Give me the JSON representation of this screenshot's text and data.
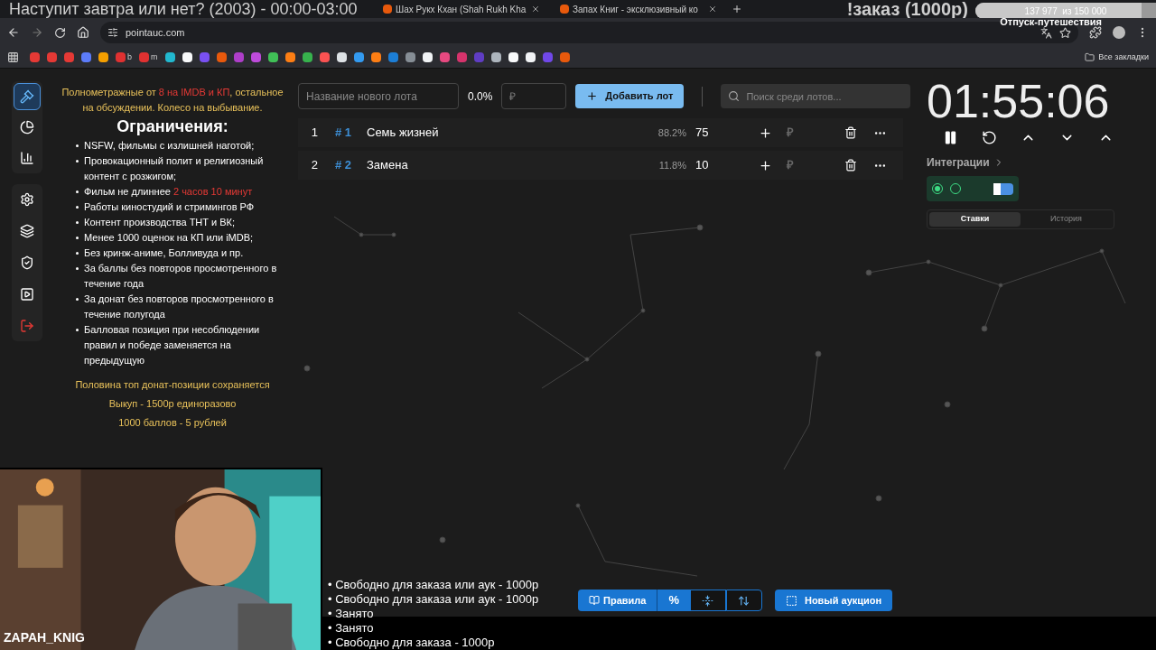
{
  "stream_title": "Наступит завтра или нет? (2003) - 00:00-03:00",
  "tabs": [
    {
      "title": "Шах Рукх Кхан (Shah Rukh Kha",
      "selected": false
    },
    {
      "title": "Запах Книг - эксклюзивный ко",
      "selected": false
    }
  ],
  "order_label": "!заказ (1000р)",
  "goal": {
    "reading": "137 977  из 150 000",
    "level": 0.92,
    "caption": "Отпуск-путешествия"
  },
  "address": "pointauc.com",
  "bookmarks": [
    {
      "color": "#e53935"
    },
    {
      "color": "#e53935"
    },
    {
      "color": "#e53935"
    },
    {
      "color": "#5c7cfa"
    },
    {
      "color": "#f59f00"
    },
    {
      "color": "#e03131",
      "label": "b"
    },
    {
      "color": "#e03131",
      "label": "m"
    },
    {
      "color": "#22b8cf"
    },
    {
      "color": "#f8f9fa"
    },
    {
      "color": "#7950f2"
    },
    {
      "color": "#e8590c"
    },
    {
      "color": "#ae3ec9"
    },
    {
      "color": "#be4bdb"
    },
    {
      "color": "#40c057"
    },
    {
      "color": "#fd7e14"
    },
    {
      "color": "#37b24d"
    },
    {
      "color": "#fa5252"
    },
    {
      "color": "#dee2e6"
    },
    {
      "color": "#339af0"
    },
    {
      "color": "#fd7e14"
    },
    {
      "color": "#1c7ed6"
    },
    {
      "color": "#868e96"
    },
    {
      "color": "#f1f3f5"
    },
    {
      "color": "#e64980"
    },
    {
      "color": "#d6336c"
    },
    {
      "color": "#5f3dc4"
    },
    {
      "color": "#adb5bd"
    },
    {
      "color": "#f8f9fa"
    },
    {
      "color": "#f1f3f5"
    },
    {
      "color": "#7048e8"
    },
    {
      "color": "#e8590c"
    }
  ],
  "all_bookmarks": "Все закладки",
  "nav": [
    {
      "kind": "gavel",
      "selected": true
    },
    {
      "kind": "pie",
      "selected": false
    },
    {
      "kind": "bars",
      "selected": false
    },
    {
      "kind": "gear",
      "selected": false
    },
    {
      "kind": "layers",
      "selected": false
    },
    {
      "kind": "shield",
      "selected": false
    },
    {
      "kind": "video",
      "selected": false
    },
    {
      "kind": "logout",
      "selected": false
    }
  ],
  "rules": {
    "intro": [
      {
        "text": "Полнометражные от ",
        "accent": false
      },
      {
        "text": "8 на IMDB и КП",
        "accent": true
      },
      {
        "text": ", остальное на обсуждении. Колесо на выбывание.",
        "accent": false
      }
    ],
    "heading": "Ограничения:",
    "items": [
      [
        {
          "text": "NSFW, фильмы с излишней наготой;",
          "accent": false
        }
      ],
      [
        {
          "text": "Провокационный полит и религиозный контент с розжигом;",
          "accent": false
        }
      ],
      [
        {
          "text": "Фильм не длиннее ",
          "accent": false
        },
        {
          "text": "2 часов 10 минут",
          "accent": true
        }
      ],
      [
        {
          "text": "Работы киностудий и стримингов РФ",
          "accent": false
        }
      ],
      [
        {
          "text": "Контент производства ТНТ и ВК;",
          "accent": false
        }
      ],
      [
        {
          "text": "Менее 1000 оценок на КП или iMDB;",
          "accent": false
        }
      ],
      [
        {
          "text": "Без кринж-аниме, Болливуда и пр.",
          "accent": false
        }
      ],
      [
        {
          "text": "За баллы без повторов просмотренного в течение года",
          "accent": false
        }
      ],
      [
        {
          "text": "За донат без повторов просмотренного в течение полугода",
          "accent": false
        }
      ],
      [
        {
          "text": "Балловая позиция при несоблюдении правил и победе заменяется на предыдущую",
          "accent": false
        }
      ]
    ],
    "footer": [
      "Половина топ донат-позиции сохраняется",
      "Выкуп - 1500р единоразово",
      "1000 баллов - 5 рублей"
    ]
  },
  "new_lot": {
    "placeholder": "Название нового лота",
    "percent": "0.0%",
    "amount_placeholder": "₽",
    "add_button": "Добавить лот"
  },
  "search": {
    "placeholder": "Поиск среди лотов..."
  },
  "lots": [
    {
      "index": "1",
      "tag": "# 1",
      "name": "Семь жизней",
      "percent": "88.2%",
      "amount": "75",
      "currency": "₽"
    },
    {
      "index": "2",
      "tag": "# 2",
      "name": "Замена",
      "percent": "11.8%",
      "amount": "10",
      "currency": "₽"
    }
  ],
  "timer": "01:55:06",
  "integrations": {
    "label": "Интеграции",
    "toggles": [
      {
        "on": true
      },
      {
        "on": false
      }
    ]
  },
  "side_tabs": [
    {
      "label": "Ставки",
      "selected": true
    },
    {
      "label": "История",
      "selected": false
    }
  ],
  "webcam": {
    "name": "ZAPAH_KNIG"
  },
  "queue": [
    "• Свободно для заказа или аук - 1000р",
    "• Свободно для заказа или аук - 1000р",
    "• Занято",
    "• Занято",
    "• Свободно для заказа - 1000р"
  ],
  "toolbar": {
    "rules_button": "Правила",
    "percent_button": "%",
    "new_auction": "Новый аукцион"
  }
}
